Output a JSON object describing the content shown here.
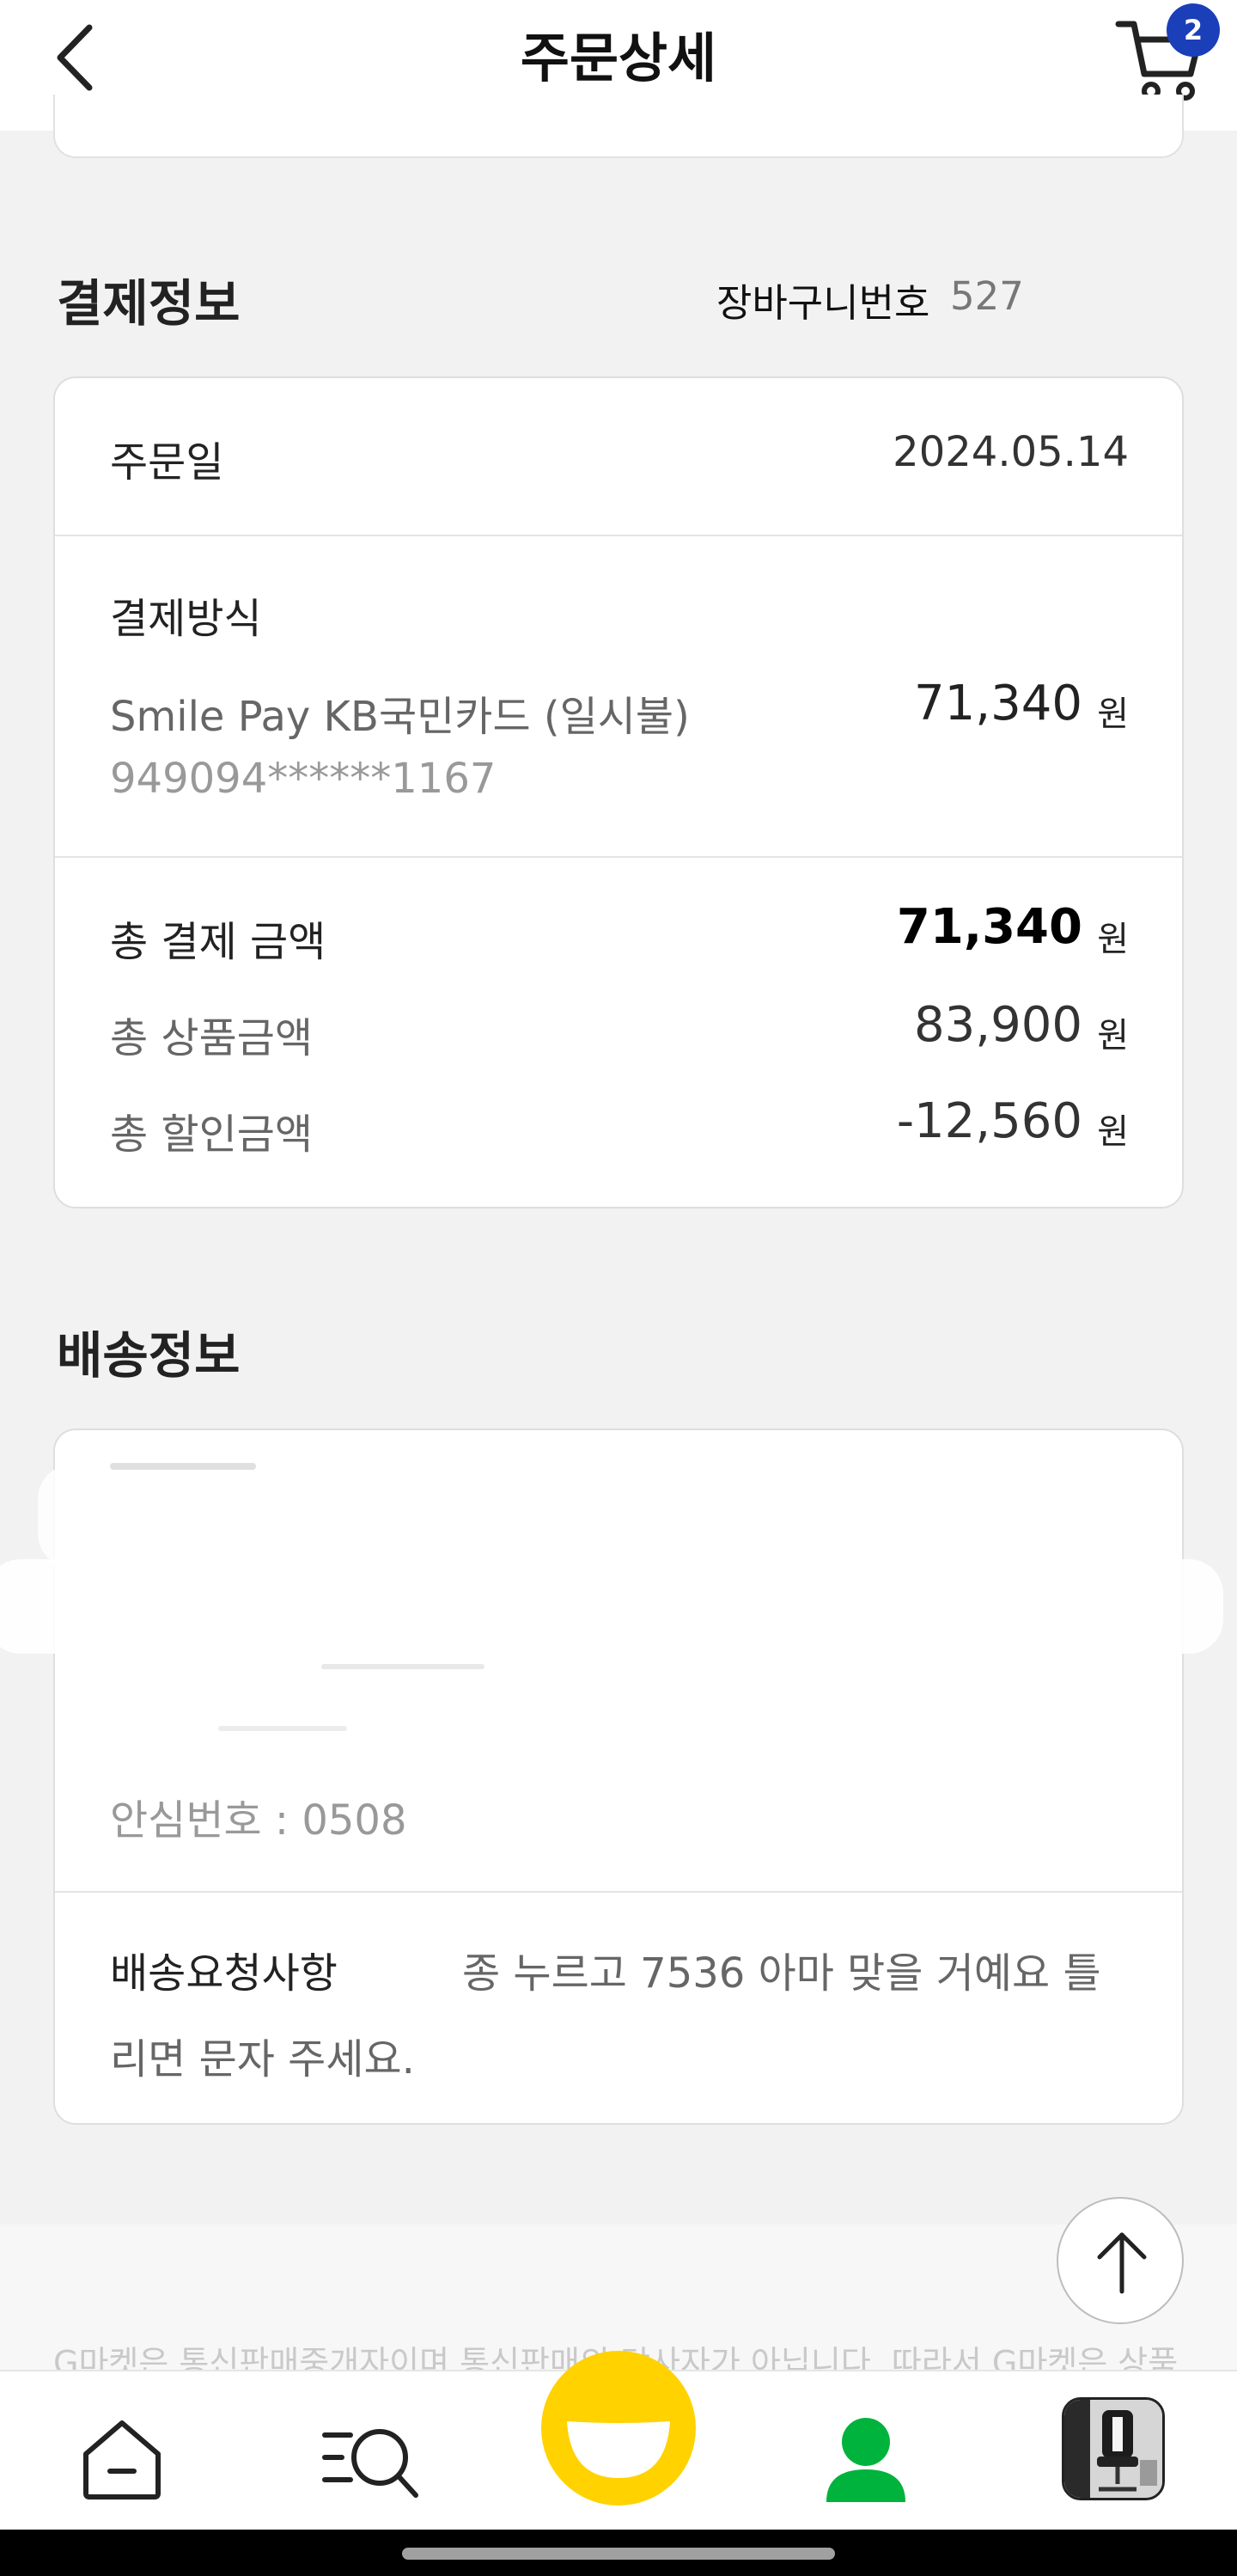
{
  "header": {
    "title": "주문상세",
    "cart_badge": "2"
  },
  "payment_section": {
    "title": "결제정보",
    "cart_number_label": "장바구니번호",
    "cart_number_value": "527",
    "order_date_label": "주문일",
    "order_date_value": "2024.05.14",
    "method_label": "결제방식",
    "method_name": "Smile Pay KB국민카드 (일시불)",
    "card_number": "949094******1167",
    "method_amount": "71,340",
    "total_payment_label": "총 결제 금액",
    "total_payment_value": "71,340",
    "total_product_label": "총 상품금액",
    "total_product_value": "83,900",
    "total_discount_label": "총 할인금액",
    "total_discount_value": "-12,560",
    "currency": "원"
  },
  "delivery_section": {
    "title": "배송정보",
    "safe_number": "안심번호 : 0508",
    "request_label": "배송요청사항",
    "request_line1": "종 누르고 7536 아마 맞을 거예요 틀",
    "request_line2": "리면 문자 주세요."
  },
  "footer": {
    "notice": "G마켓은 통신판매중개자이며 통신판매의 당사자가 아닙니다. 따라서 G마켓은 상품"
  },
  "bottom_nav": {
    "items": [
      "home",
      "category-search",
      "smile",
      "my-page",
      "recent-item"
    ]
  },
  "colors": {
    "badge": "#1a3fb8",
    "smile_yellow": "#ffd200",
    "my_page_green": "#00b33c"
  }
}
